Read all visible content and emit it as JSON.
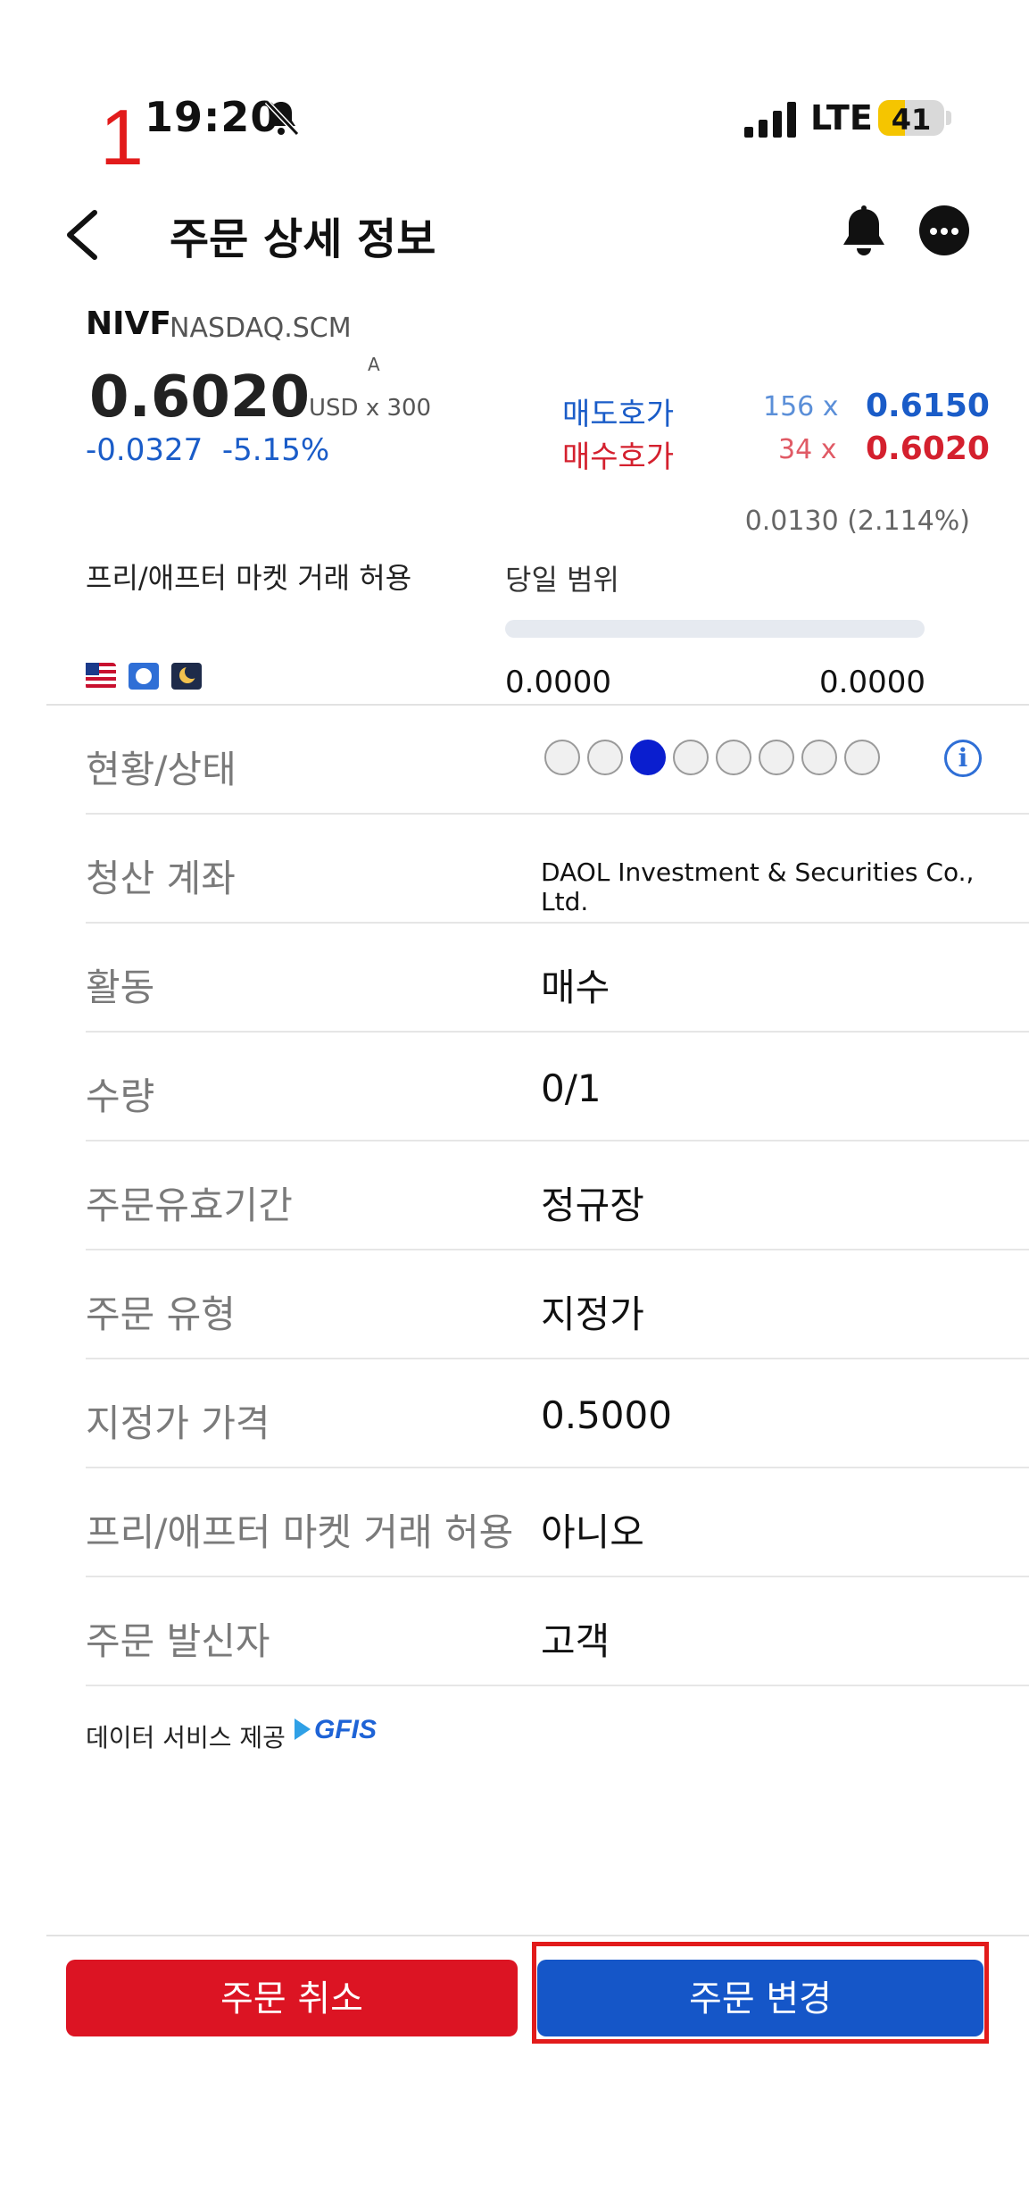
{
  "annotation": {
    "marker": "1"
  },
  "status_bar": {
    "time": "19:20",
    "network": "LTE",
    "battery": "41",
    "battery_level": 0.41
  },
  "header": {
    "title": "주문 상세 정보"
  },
  "quote": {
    "ticker": "NIVF",
    "exchange": "NASDAQ.SCM",
    "price": "0.6020",
    "tag": "A",
    "unit": "USD x 300",
    "change": "-0.0327  -5.15%",
    "ask_label": "매도호가",
    "bid_label": "매수호가",
    "ask_size": "156 x",
    "bid_size": "34 x",
    "ask_price": "0.6150",
    "bid_price": "0.6020",
    "spread": "0.0130 (2.114%)"
  },
  "session": {
    "pre_after_label": "프리/애프터 마켓 거래 허용",
    "range_label": "당일 범위",
    "range_low": "0.0000",
    "range_high": "0.0000",
    "icons": [
      "us-flag-icon",
      "clock-icon",
      "moon-icon"
    ]
  },
  "details": {
    "status": {
      "label": "현황/상태",
      "steps_total": 8,
      "active_step": 3
    },
    "account": {
      "label": "청산 계좌",
      "value": "DAOL Investment & Securities Co., Ltd."
    },
    "action": {
      "label": "활동",
      "value": "매수"
    },
    "quantity": {
      "label": "수량",
      "value": "0/1"
    },
    "validity": {
      "label": "주문유효기간",
      "value": "정규장"
    },
    "order_type": {
      "label": "주문 유형",
      "value": "지정가"
    },
    "limit_price": {
      "label": "지정가 가격",
      "value": "0.5000"
    },
    "pre_after": {
      "label": "프리/애프터 마켓 거래 허용",
      "value": "아니오"
    },
    "sender": {
      "label": "주문 발신자",
      "value": "고객"
    }
  },
  "provider": {
    "label": "데이터 서비스 제공",
    "logo": "GFIS"
  },
  "actions": {
    "cancel": "주문 취소",
    "modify": "주문 변경"
  },
  "colors": {
    "up_blue": "#1a5cc8",
    "down_red": "#d4202e",
    "cancel_bg": "#dc1423",
    "modify_bg": "#1556c8",
    "highlight": "#e21b1b"
  }
}
